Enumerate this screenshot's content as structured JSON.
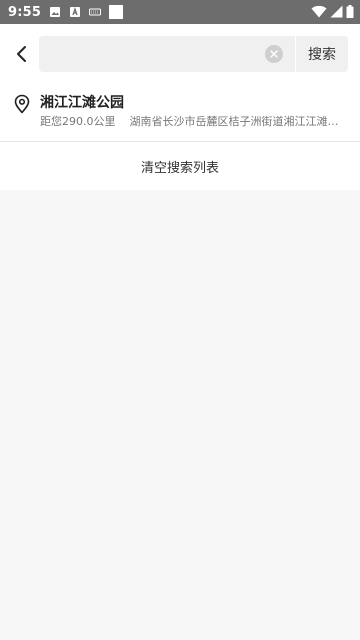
{
  "status_bar": {
    "time": "9:55",
    "left_icons": [
      "image-icon",
      "font-icon",
      "keyboard-icon",
      "square-icon"
    ],
    "right_icons": [
      "wifi-icon",
      "cellular-icon",
      "battery-icon"
    ]
  },
  "search": {
    "value": "",
    "placeholder": "",
    "button_label": "搜索"
  },
  "results": [
    {
      "title": "湘江江滩公园",
      "distance": "距您290.0公里",
      "address": "湖南省长沙市岳麓区桔子洲街道湘江江滩公园"
    }
  ],
  "clear_list_label": "清空搜索列表",
  "colors": {
    "status_bar_bg": "#6d6d6d",
    "page_bg": "#f7f7f7",
    "search_box_bg": "#f0f0f0",
    "title_text": "#222222",
    "secondary_text": "#777777"
  }
}
